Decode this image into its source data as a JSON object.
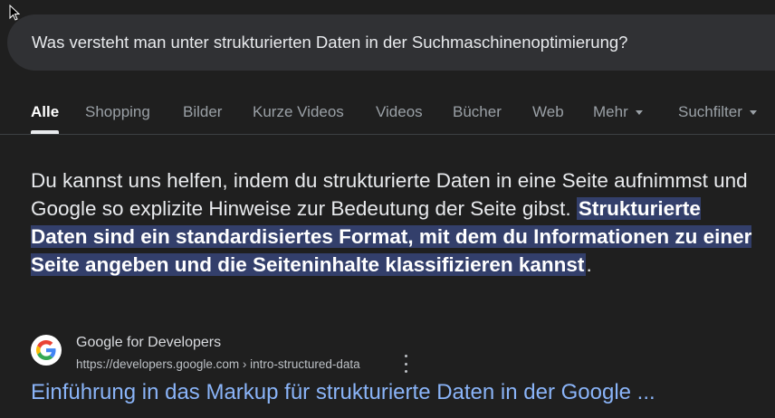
{
  "search": {
    "query": "Was versteht man unter strukturierten Daten in der Suchmaschinenoptimierung?"
  },
  "tabs": [
    {
      "label": "Alle",
      "active": true
    },
    {
      "label": "Shopping"
    },
    {
      "label": "Bilder"
    },
    {
      "label": "Kurze Videos"
    },
    {
      "label": "Videos"
    },
    {
      "label": "Bücher"
    },
    {
      "label": "Web"
    },
    {
      "label": "Mehr"
    },
    {
      "label": "Suchfilter"
    }
  ],
  "snippet": {
    "text_before": "Du kannst uns helfen, indem du strukturierte Daten in eine Seite aufnimmst und Google so explizite Hinweise zur Bedeutung der Seite gibst. ",
    "highlight": "Strukturierte Daten sind ein standardisiertes Format, mit dem du Informationen zu einer Seite angeben und die Seiteninhalte klassifizieren kannst",
    "text_after": "."
  },
  "result": {
    "site_name": "Google for Developers",
    "url": "https://developers.google.com › intro-structured-data",
    "title": "Einführung in das Markup für strukturierte Daten in der Google ..."
  },
  "colors": {
    "background": "#1f1f1f",
    "searchbar": "#303134",
    "highlight": "#333f6b",
    "link": "#8ab4f8"
  }
}
